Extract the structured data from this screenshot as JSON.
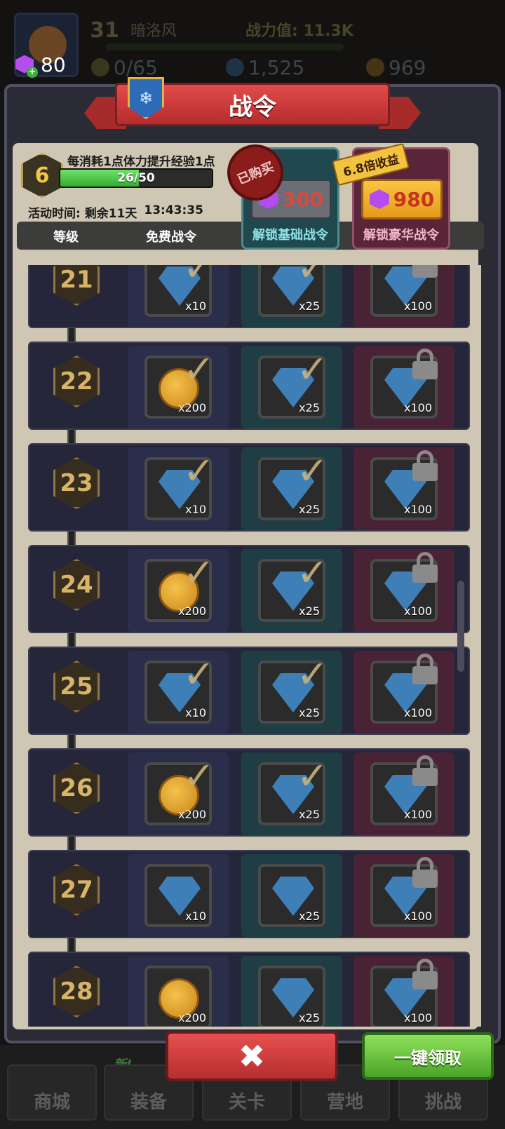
{
  "hud": {
    "gems": "80",
    "level": "31",
    "player_name": "暗洛风",
    "power_label": "战力值: 11.3K",
    "stamina": "0/65",
    "diamonds": "1,525",
    "coins": "969"
  },
  "panel": {
    "title": "战令",
    "exp_desc": "每消耗1点体力提升经验1点",
    "current_level": "6",
    "exp_text": "26/50",
    "exp_progress": 0.52,
    "time_label": "活动时间: 剩余11天",
    "time_value": "13:43:35",
    "col_level": "等级",
    "col_free": "免费战令",
    "purchased_stamp": "已购买",
    "bonus_tag": "6.8倍收益",
    "basic": {
      "price": "300",
      "label": "解锁基础战令"
    },
    "lux": {
      "price": "980",
      "label": "解锁豪华战令"
    }
  },
  "rows": [
    {
      "level": "21",
      "free": {
        "type": "diamond",
        "qty": "x10",
        "claimed": true
      },
      "basic": {
        "type": "diamond",
        "qty": "x25",
        "claimed": true
      },
      "lux": {
        "type": "diamond",
        "qty": "x100",
        "locked": true
      }
    },
    {
      "level": "22",
      "free": {
        "type": "coin",
        "qty": "x200",
        "claimed": true
      },
      "basic": {
        "type": "diamond",
        "qty": "x25",
        "claimed": true
      },
      "lux": {
        "type": "diamond",
        "qty": "x100",
        "locked": true
      }
    },
    {
      "level": "23",
      "free": {
        "type": "diamond",
        "qty": "x10",
        "claimed": true
      },
      "basic": {
        "type": "diamond",
        "qty": "x25",
        "claimed": true
      },
      "lux": {
        "type": "diamond",
        "qty": "x100",
        "locked": true
      }
    },
    {
      "level": "24",
      "free": {
        "type": "coin",
        "qty": "x200",
        "claimed": true
      },
      "basic": {
        "type": "diamond",
        "qty": "x25",
        "claimed": true
      },
      "lux": {
        "type": "diamond",
        "qty": "x100",
        "locked": true
      }
    },
    {
      "level": "25",
      "free": {
        "type": "diamond",
        "qty": "x10",
        "claimed": true
      },
      "basic": {
        "type": "diamond",
        "qty": "x25",
        "claimed": true
      },
      "lux": {
        "type": "diamond",
        "qty": "x100",
        "locked": true
      }
    },
    {
      "level": "26",
      "free": {
        "type": "coin",
        "qty": "x200",
        "claimed": true
      },
      "basic": {
        "type": "diamond",
        "qty": "x25",
        "claimed": true
      },
      "lux": {
        "type": "diamond",
        "qty": "x100",
        "locked": true
      }
    },
    {
      "level": "27",
      "free": {
        "type": "diamond",
        "qty": "x10",
        "claimed": false
      },
      "basic": {
        "type": "diamond",
        "qty": "x25",
        "claimed": false
      },
      "lux": {
        "type": "diamond",
        "qty": "x100",
        "locked": true
      }
    },
    {
      "level": "28",
      "free": {
        "type": "coin",
        "qty": "x200",
        "claimed": false
      },
      "basic": {
        "type": "diamond",
        "qty": "x25",
        "claimed": false
      },
      "lux": {
        "type": "diamond",
        "qty": "x100",
        "locked": true
      }
    }
  ],
  "buttons": {
    "close": "✖",
    "claim_all": "一键领取"
  },
  "nav": {
    "badge_new": "新!",
    "items": [
      "商城",
      "装备",
      "关卡",
      "营地",
      "挑战"
    ]
  },
  "colors": {
    "accent_red": "#b52c2c",
    "claim_green": "#4aa528",
    "gem_purple": "#b44cf0"
  }
}
